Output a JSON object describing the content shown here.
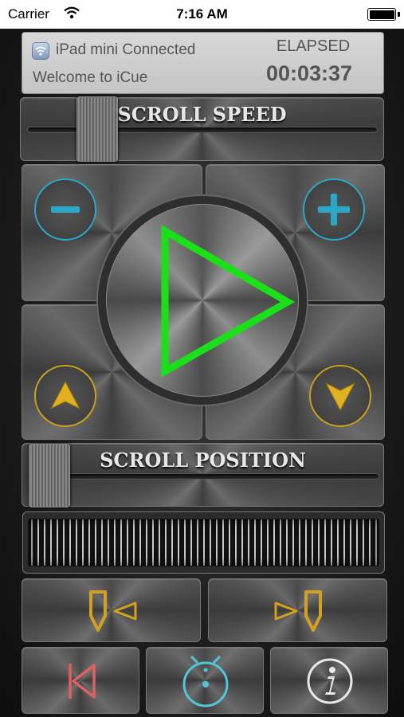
{
  "status_bar": {
    "carrier": "Carrier",
    "time": "7:16 AM"
  },
  "info_panel": {
    "connection": "iPad mini Connected",
    "welcome": "Welcome to iCue",
    "elapsed_label": "ELAPSED",
    "elapsed_value": "00:03:37"
  },
  "scroll_speed": {
    "label": "SCROLL SPEED"
  },
  "scroll_position": {
    "label": "SCROLL POSITION"
  },
  "icons": {
    "minus": "minus-icon",
    "plus": "plus-icon",
    "play": "play-icon",
    "up": "arrow-up-icon",
    "down": "arrow-down-icon",
    "mark_left": "cue-marker-left-icon",
    "mark_right": "cue-marker-right-icon",
    "skip_back": "skip-to-start-icon",
    "timer": "timer-icon",
    "info": "info-icon"
  },
  "colors": {
    "play": "#19e019",
    "speed_buttons": "#2aa8c8",
    "direction_buttons": "#c8a020",
    "markers": "#d4a020",
    "skip_back": "#e06060",
    "timer": "#4ec8d8"
  }
}
